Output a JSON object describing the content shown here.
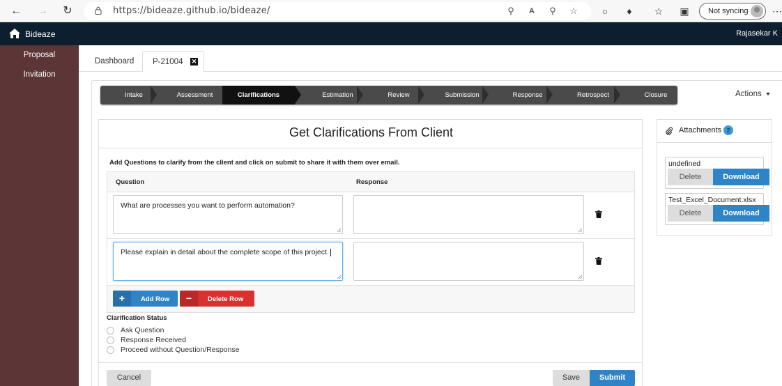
{
  "browser": {
    "url": "https://bideaze.github.io/bideaze/",
    "sync_label": "Not syncing"
  },
  "app": {
    "brand": "Bideaze",
    "user": "Rajasekar K"
  },
  "sidebar": {
    "items": [
      {
        "label": "Proposal"
      },
      {
        "label": "Invitation"
      }
    ]
  },
  "tabs": [
    {
      "label": "Dashboard",
      "active": false
    },
    {
      "label": "P-21004",
      "active": true,
      "closable": true
    }
  ],
  "wizard": {
    "steps": [
      "Intake",
      "Assessment",
      "Clarifications",
      "Estimation",
      "Review",
      "Submission",
      "Response",
      "Retrospect",
      "Closure"
    ],
    "active_step": "Clarifications",
    "actions_label": "Actions"
  },
  "clarifications": {
    "title": "Get Clarifications From Client",
    "instruction": "Add Questions to clarify from the client and click on submit to share it with them over email.",
    "columns": {
      "question": "Question",
      "response": "Response"
    },
    "rows": [
      {
        "question": "What are processes you want to perform automation?",
        "response": ""
      },
      {
        "question": "Please explain in detail about the complete scope of this project.",
        "response": ""
      }
    ],
    "add_row_label": "Add Row",
    "delete_row_label": "Delete Row",
    "status_label": "Clarification Status",
    "status_options": [
      "Ask Question",
      "Response Received",
      "Proceed without Question/Response"
    ],
    "cancel_label": "Cancel",
    "save_label": "Save",
    "submit_label": "Submit"
  },
  "attachments": {
    "title": "Attachments",
    "count": "2",
    "items": [
      {
        "name": "undefined",
        "delete_label": "Delete",
        "download_label": "Download"
      },
      {
        "name": "Test_Excel_Document.xlsx",
        "delete_label": "Delete",
        "download_label": "Download"
      }
    ]
  },
  "colors": {
    "navbar": "#0d1f2e",
    "sidebar": "#5c3536",
    "primary": "#2f84c8",
    "danger": "#d9312f"
  }
}
